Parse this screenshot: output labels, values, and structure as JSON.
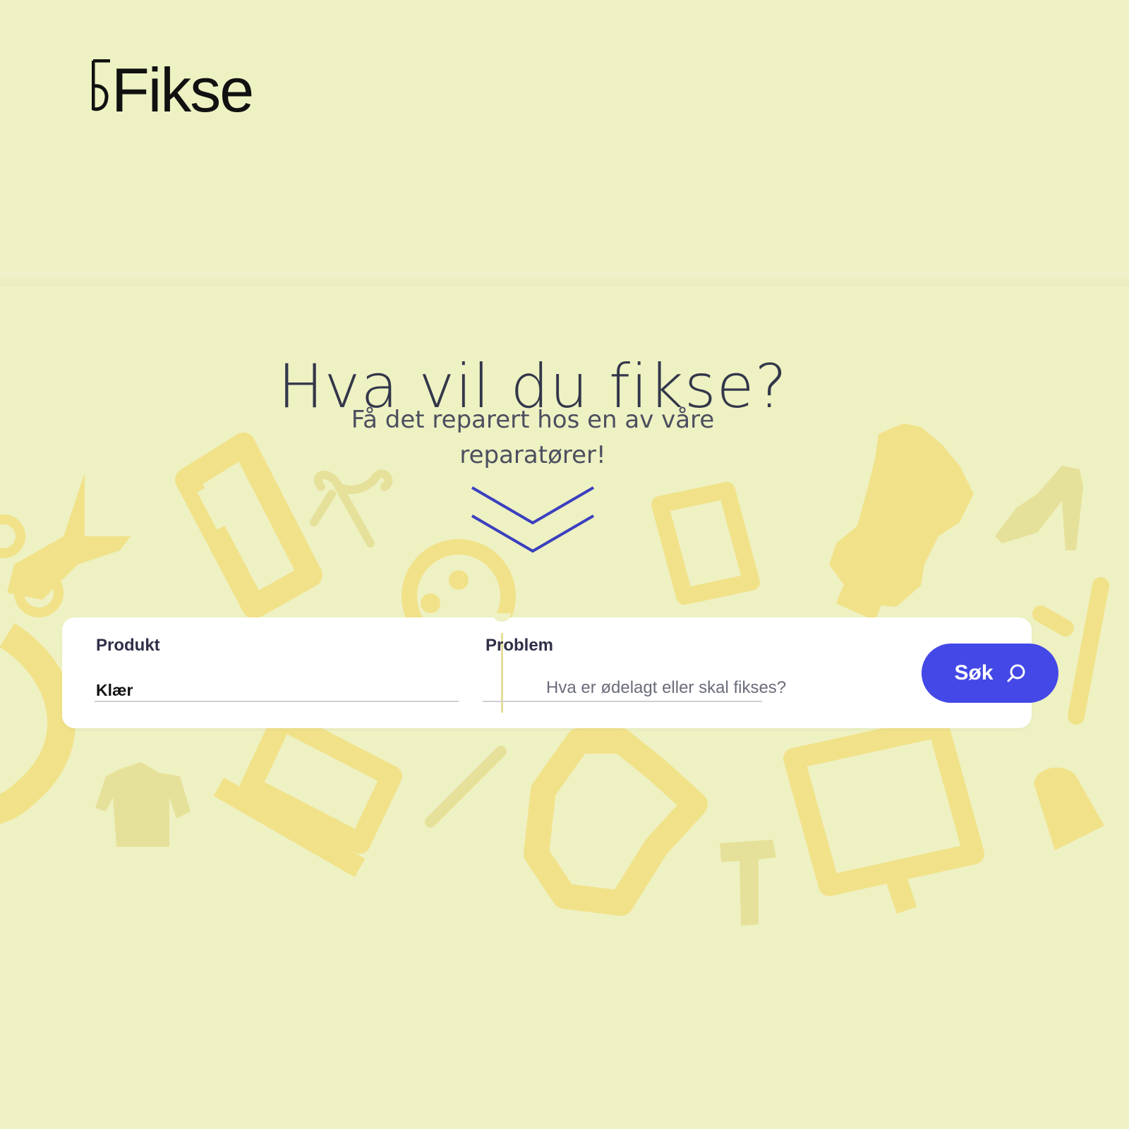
{
  "brand": {
    "name": "Fikse"
  },
  "hero": {
    "headline": "Hva vil du fikse?",
    "subline": "Få det reparert hos en av våre reparatører!"
  },
  "search": {
    "product": {
      "label": "Produkt",
      "value": "Klær"
    },
    "problem": {
      "label": "Problem",
      "placeholder": "Hva er ødelagt eller skal fikses?"
    },
    "button_label": "Søk"
  },
  "icons": [
    "scissors-icon",
    "phone-icon",
    "safety-pin-icon",
    "button-icon",
    "tablet-icon",
    "mannequin-icon",
    "high-heel-icon",
    "measuring-tape-icon",
    "jacket-icon",
    "laptop-icon",
    "needle-icon",
    "shirt-icon",
    "hammer-icon",
    "monitor-icon",
    "thimble-icon",
    "chevron-down-icon",
    "search-icon"
  ],
  "colors": {
    "background": "#eef1c2",
    "icon_yellow": "#f1e28a",
    "accent": "#4348e6",
    "text_dark": "#33374a"
  }
}
